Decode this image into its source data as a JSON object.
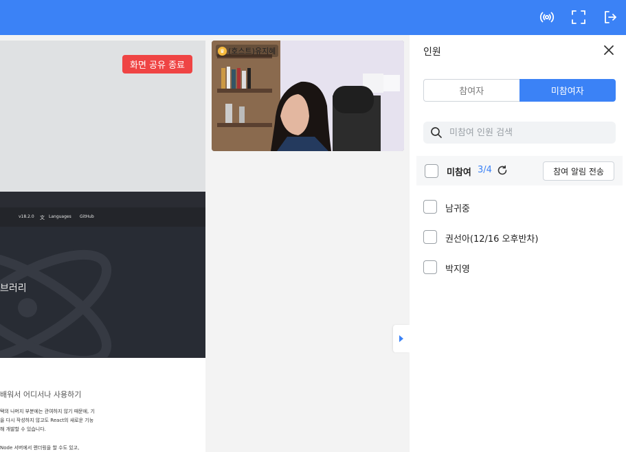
{
  "topbar": {
    "icons": [
      "broadcast-icon",
      "fullscreen-icon",
      "exit-icon"
    ]
  },
  "stage": {
    "end_share_label": "화면 공유 종료",
    "shared_screen": {
      "nav_version": "v18.2.0",
      "nav_languages": "Languages",
      "nav_github": "GitHub",
      "hero_heading": "브러리",
      "doc_subtitle": "배워서 어디서나 사용하기",
      "doc_lines": [
        "택의 나머지 부분에는 관여하지 않기 때문에, 기",
        "을 다시 작성하지 않고도 React의 새로운 기능",
        "해 개발할 수 있습니다.",
        "Node 서버에서 렌더링을 할 수도 있고,"
      ]
    },
    "video": {
      "host_label": "(호스트)유지혜"
    }
  },
  "panel": {
    "title": "인원",
    "tabs": [
      {
        "label": "참여자",
        "active": false
      },
      {
        "label": "미참여자",
        "active": true
      }
    ],
    "search_placeholder": "미참여 인원 검색",
    "absent_label": "미참여",
    "absent_count": "3/4",
    "notify_label": "참여 알림 전송",
    "people": [
      "남귀중",
      "권선아(12/16 오후반차)",
      "박지영"
    ]
  },
  "colors": {
    "accent": "#3b82f6",
    "danger": "#ef4444"
  }
}
